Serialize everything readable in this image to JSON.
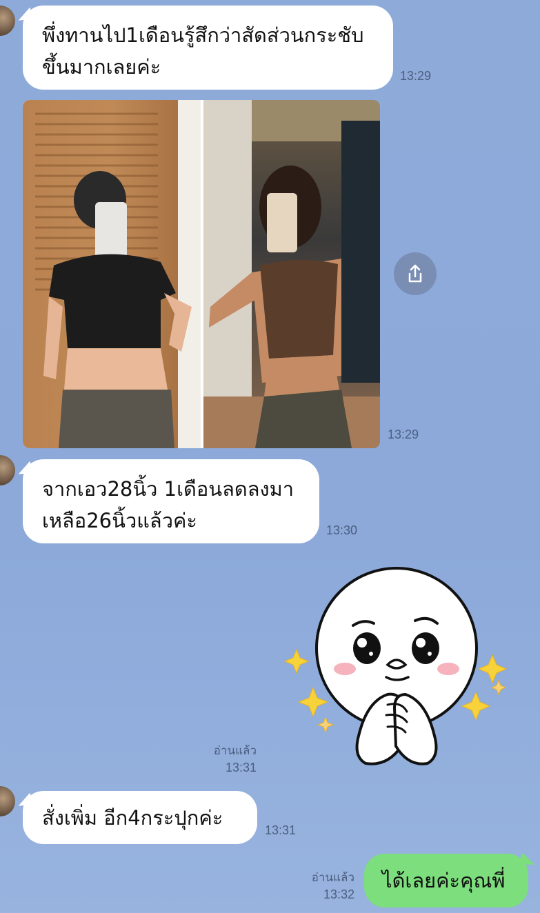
{
  "messages": [
    {
      "text_line1": "พึ่งทานไป1เดือนรู้สึกว่าสัดส่วนกระชับ",
      "text_line2": "ขึ้นมากเลยค่ะ",
      "time": "13:29"
    },
    {
      "photo_time": "13:29"
    },
    {
      "text_line1": "จากเอว28นิ้ว 1เดือนลดลงมา",
      "text_line2": "เหลือ26นิ้วแล้วค่ะ",
      "time": "13:30"
    },
    {
      "sticker_read": "อ่านแล้ว",
      "sticker_time": "13:31"
    },
    {
      "text": "สั่งเพิ่ม อีก4กระปุกค่ะ",
      "time": "13:31"
    },
    {
      "text": "ได้เลยค่ะคุณพี่",
      "read": "อ่านแล้ว",
      "time": "13:32"
    }
  ],
  "colors": {
    "background": "#8fa9d9",
    "incoming_bubble": "#ffffff",
    "outgoing_bubble": "#7dde7d",
    "timestamp": "#4a5f80"
  },
  "icons": {
    "share": "share-icon",
    "sticker": "crying-moon-sticker"
  }
}
